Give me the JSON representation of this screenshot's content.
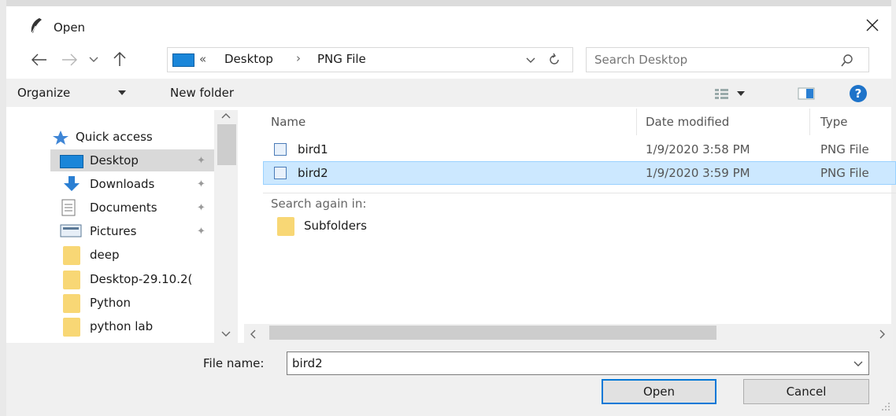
{
  "window": {
    "title": "Open"
  },
  "address": {
    "overflow": "«",
    "crumbs": [
      "Desktop",
      "PNG File"
    ]
  },
  "search": {
    "placeholder": "Search Desktop"
  },
  "toolbar": {
    "organize_label": "Organize",
    "new_folder_label": "New folder"
  },
  "sidebar": {
    "items": [
      {
        "label": "Quick access",
        "icon": "star-icon"
      },
      {
        "label": "Desktop",
        "icon": "desktop-icon",
        "selected": true,
        "pinned": true
      },
      {
        "label": "Downloads",
        "icon": "download-icon",
        "pinned": true
      },
      {
        "label": "Documents",
        "icon": "documents-icon",
        "pinned": true
      },
      {
        "label": "Pictures",
        "icon": "pictures-icon",
        "pinned": true
      },
      {
        "label": "deep",
        "icon": "folder-icon"
      },
      {
        "label": "Desktop-29.10.2(",
        "icon": "folder-icon"
      },
      {
        "label": "Python",
        "icon": "folder-icon"
      },
      {
        "label": "python lab",
        "icon": "folder-icon"
      }
    ]
  },
  "file_list": {
    "columns": [
      "Name",
      "Date modified",
      "Type"
    ],
    "rows": [
      {
        "name": "bird1",
        "date": "1/9/2020 3:58 PM",
        "type": "PNG File"
      },
      {
        "name": "bird2",
        "date": "1/9/2020 3:59 PM",
        "type": "PNG File",
        "selected": true
      }
    ],
    "search_again_label": "Search again in:",
    "subfolders_label": "Subfolders"
  },
  "footer": {
    "file_name_label": "File name:",
    "file_name_value": "bird2",
    "open_label": "Open",
    "cancel_label": "Cancel"
  },
  "colors": {
    "selection": "#cce8ff",
    "accent": "#0078d7",
    "folder": "#f8d775",
    "help": "#1e73c9"
  }
}
